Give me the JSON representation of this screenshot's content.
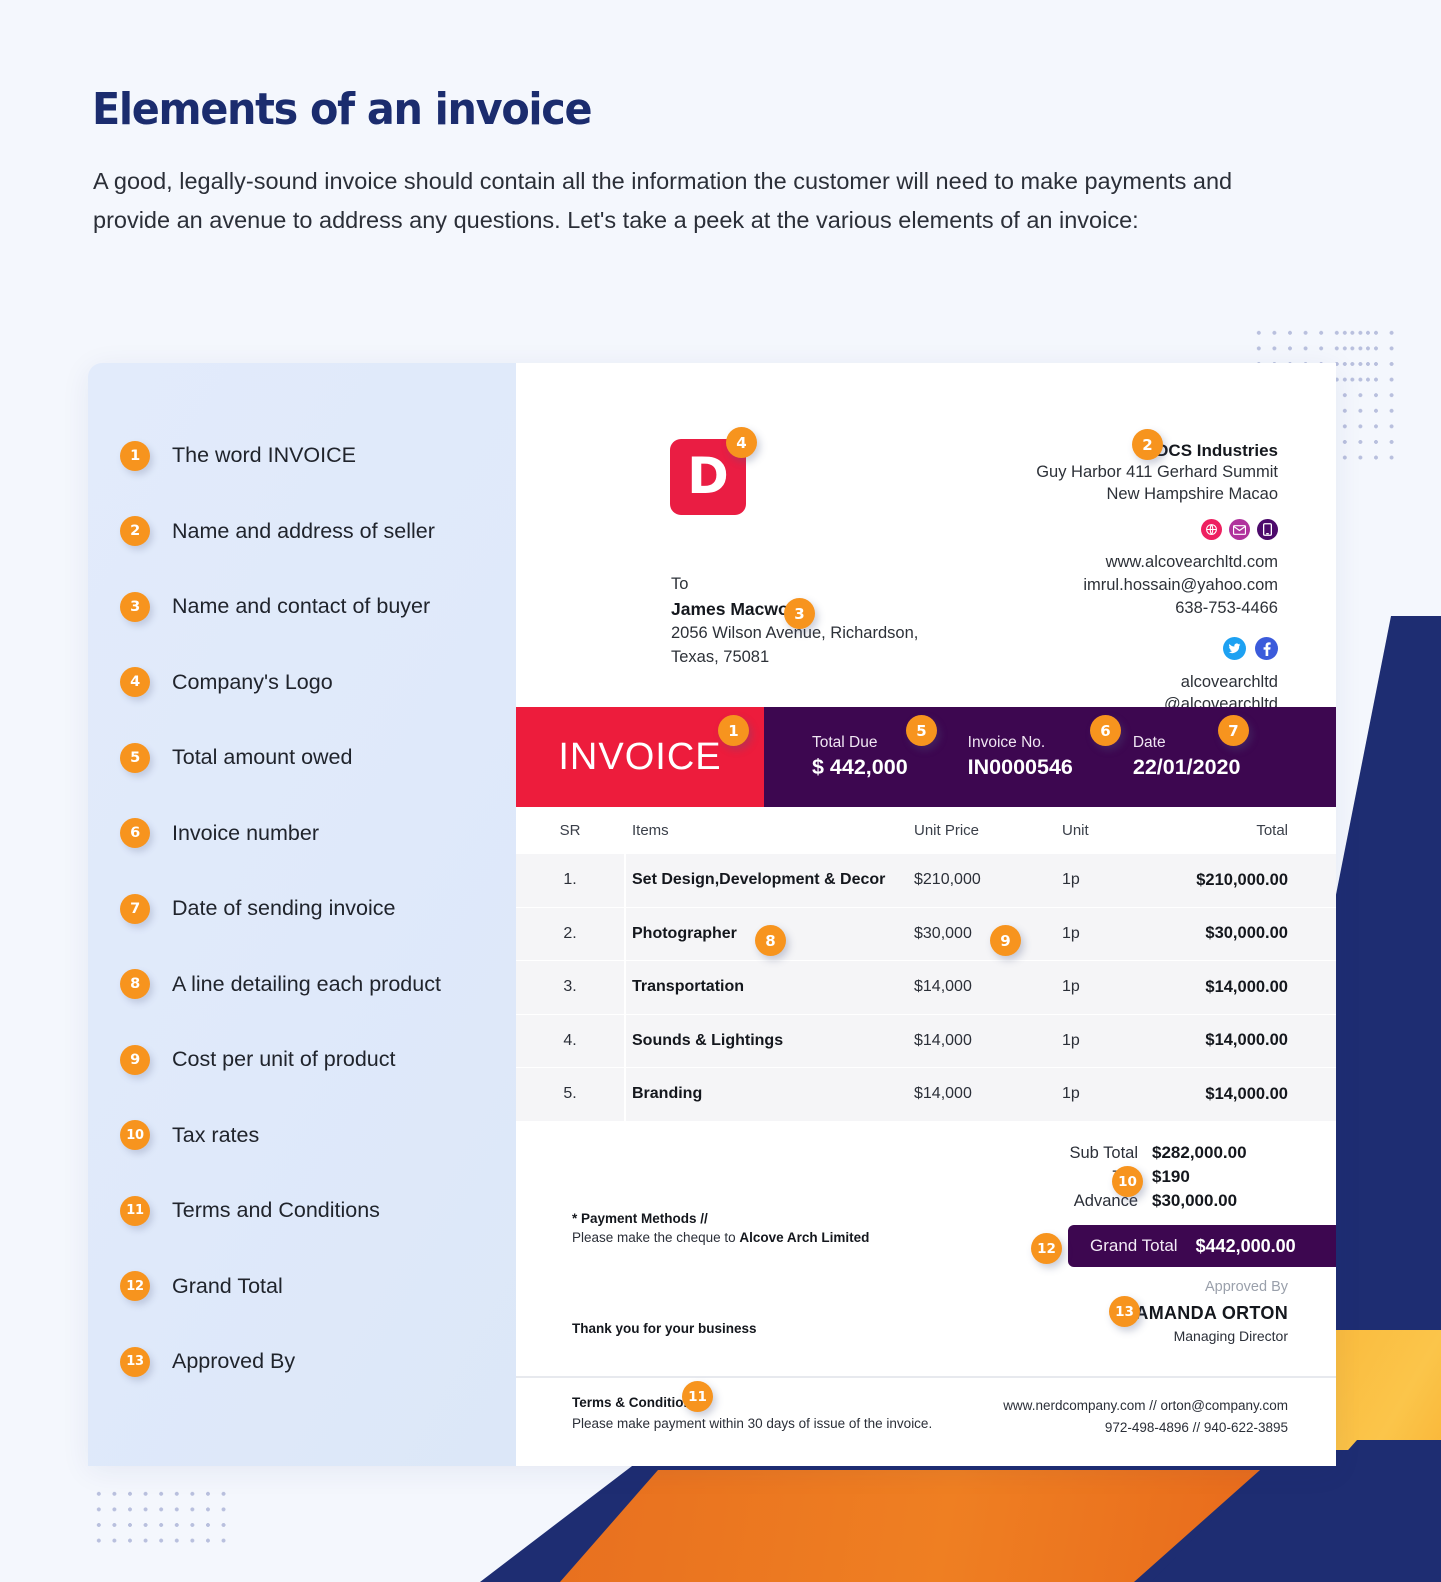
{
  "page": {
    "headline": "Elements of an invoice",
    "intro": "A good, legally-sound invoice should contain all the information the customer will need to make payments and provide an avenue to address any questions. Let's take a peek at the various elements of an invoice:"
  },
  "colors": {
    "navy": "#1e2d72",
    "orange_badge": "#f7941e",
    "invoice_red": "#ed1c3c",
    "invoice_purple": "#3d0750",
    "logo_red": "#ea1d43",
    "card_left_bg": "#e0e9fa",
    "page_bg": "#f4f7fd",
    "stripe_yellow": "#f9b233",
    "stripe_orange": "#e8701f"
  },
  "legend": [
    {
      "num": "1",
      "label": "The word INVOICE"
    },
    {
      "num": "2",
      "label": "Name and address of seller"
    },
    {
      "num": "3",
      "label": "Name and contact of buyer"
    },
    {
      "num": "4",
      "label": "Company's Logo"
    },
    {
      "num": "5",
      "label": "Total amount owed"
    },
    {
      "num": "6",
      "label": "Invoice number"
    },
    {
      "num": "7",
      "label": "Date of sending invoice"
    },
    {
      "num": "8",
      "label": "A line detailing each product"
    },
    {
      "num": "9",
      "label": "Cost per unit of product"
    },
    {
      "num": "10",
      "label": "Tax rates"
    },
    {
      "num": "11",
      "label": "Terms and Conditions"
    },
    {
      "num": "12",
      "label": "Grand Total"
    },
    {
      "num": "13",
      "label": "Approved By"
    }
  ],
  "invoice": {
    "logo_letter": "D",
    "pin_logo": "4",
    "pin_buyer": "3",
    "pin_seller": "2",
    "pin_invoice_word": "1",
    "pin_total_due": "5",
    "pin_invoice_no": "6",
    "pin_date": "7",
    "pin_item_line": "8",
    "pin_unit_price": "9",
    "pin_tax": "10",
    "pin_terms": "11",
    "pin_grand_total": "12",
    "pin_approved_by": "13",
    "buyer": {
      "to_label": "To",
      "name": "James Macwon",
      "address_line1": "2056  Wilson Avenue, Richardson,",
      "address_line2": "Texas, 75081"
    },
    "seller": {
      "name": "DCS Industries",
      "address_line1": "Guy Harbor 411 Gerhard Summit",
      "address_line2": "New Hampshire Macao",
      "website": "www.alcovearchltd.com",
      "email": "imrul.hossain@yahoo.com",
      "phone": "638-753-4466",
      "twitter_handle": "alcovearchltd",
      "facebook_handle": "@alcovearchltd",
      "icons": [
        "globe-icon",
        "mail-icon",
        "mobile-icon",
        "twitter-icon",
        "facebook-icon"
      ]
    },
    "banner": {
      "word": "INVOICE",
      "total_due_label": "Total Due",
      "total_due_value": "$ 442,000",
      "invoice_no_label": "Invoice No.",
      "invoice_no_value": "IN0000546",
      "date_label": "Date",
      "date_value": "22/01/2020"
    },
    "table": {
      "headers": [
        "SR",
        "Items",
        "Unit Price",
        "Unit",
        "Total"
      ],
      "rows": [
        {
          "sr": "1.",
          "item": "Set Design,Development & Decor",
          "price": "$210,000",
          "unit": "1p",
          "total": "$210,000.00"
        },
        {
          "sr": "2.",
          "item": "Photographer",
          "price": "$30,000",
          "unit": "1p",
          "total": "$30,000.00"
        },
        {
          "sr": "3.",
          "item": "Transportation",
          "price": "$14,000",
          "unit": "1p",
          "total": "$14,000.00"
        },
        {
          "sr": "4.",
          "item": "Sounds & Lightings",
          "price": "$14,000",
          "unit": "1p",
          "total": "$14,000.00"
        },
        {
          "sr": "5.",
          "item": "Branding",
          "price": "$14,000",
          "unit": "1p",
          "total": "$14,000.00"
        }
      ]
    },
    "totals": {
      "sub_total_label": "Sub Total",
      "sub_total_value": "$282,000.00",
      "tax_label": "Tax",
      "tax_value": "$190",
      "advance_label": "Advance",
      "advance_value": "$30,000.00",
      "grand_total_label": "Grand Total",
      "grand_total_value": "$442,000.00"
    },
    "payment": {
      "title": "* Payment Methods //",
      "line_prefix": "Please make the cheque to ",
      "payee": "Alcove Arch Limited",
      "thanks": "Thank you for your business"
    },
    "approval": {
      "approved_by_label": "Approved By",
      "name": "AMANDA ORTON",
      "role": "Managing Director"
    },
    "footer": {
      "terms_title": "Terms & Conditions",
      "terms_text": "Please make payment within 30 days of issue of the invoice.",
      "contact_line1": "www.nerdcompany.com  // orton@company.com",
      "contact_line2": "972-498-4896  // 940-622-3895"
    }
  }
}
